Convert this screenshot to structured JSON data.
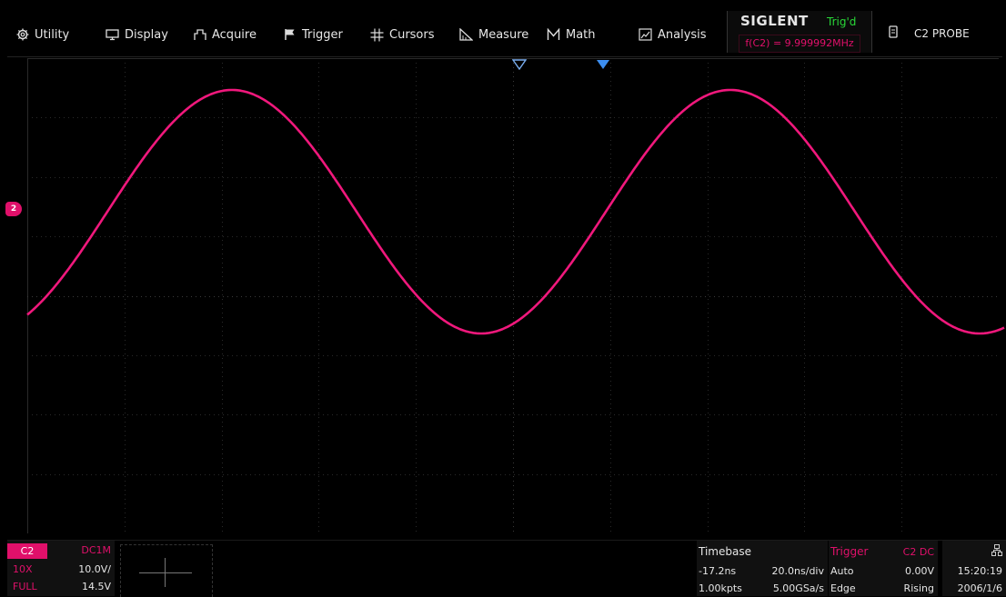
{
  "menu": {
    "items": [
      {
        "name": "utility",
        "label": "Utility",
        "icon": "gear-icon"
      },
      {
        "name": "display",
        "label": "Display",
        "icon": "monitor-icon"
      },
      {
        "name": "acquire",
        "label": "Acquire",
        "icon": "acquire-icon"
      },
      {
        "name": "trigger",
        "label": "Trigger",
        "icon": "flag-icon"
      },
      {
        "name": "cursors",
        "label": "Cursors",
        "icon": "cursors-icon"
      },
      {
        "name": "measure",
        "label": "Measure",
        "icon": "ruler-icon"
      },
      {
        "name": "math",
        "label": "Math",
        "icon": "math-icon"
      },
      {
        "name": "analysis",
        "label": "Analysis",
        "icon": "analysis-icon"
      }
    ]
  },
  "status": {
    "brand": "SIGLENT",
    "trigger_state": "Trig'd",
    "frequency": "f(C2) = 9.999992MHz",
    "probe_label": "C2 PROBE"
  },
  "channel": {
    "name": "C2",
    "coupling": "DC1M",
    "probe": "10X",
    "scale": "10.0V/",
    "bandwidth": "FULL",
    "offset": "14.5V",
    "marker": "2",
    "color": "#e0106a"
  },
  "timebase": {
    "title": "Timebase",
    "delay": "-17.2ns",
    "scale": "20.0ns/div",
    "points": "1.00kpts",
    "sample_rate": "5.00GSa/s"
  },
  "trigger": {
    "title": "Trigger",
    "source": "C2 DC",
    "mode": "Auto",
    "level": "0.00V",
    "type": "Edge",
    "slope": "Rising"
  },
  "clock": {
    "time": "15:20:19",
    "date": "2006/1/6"
  }
}
